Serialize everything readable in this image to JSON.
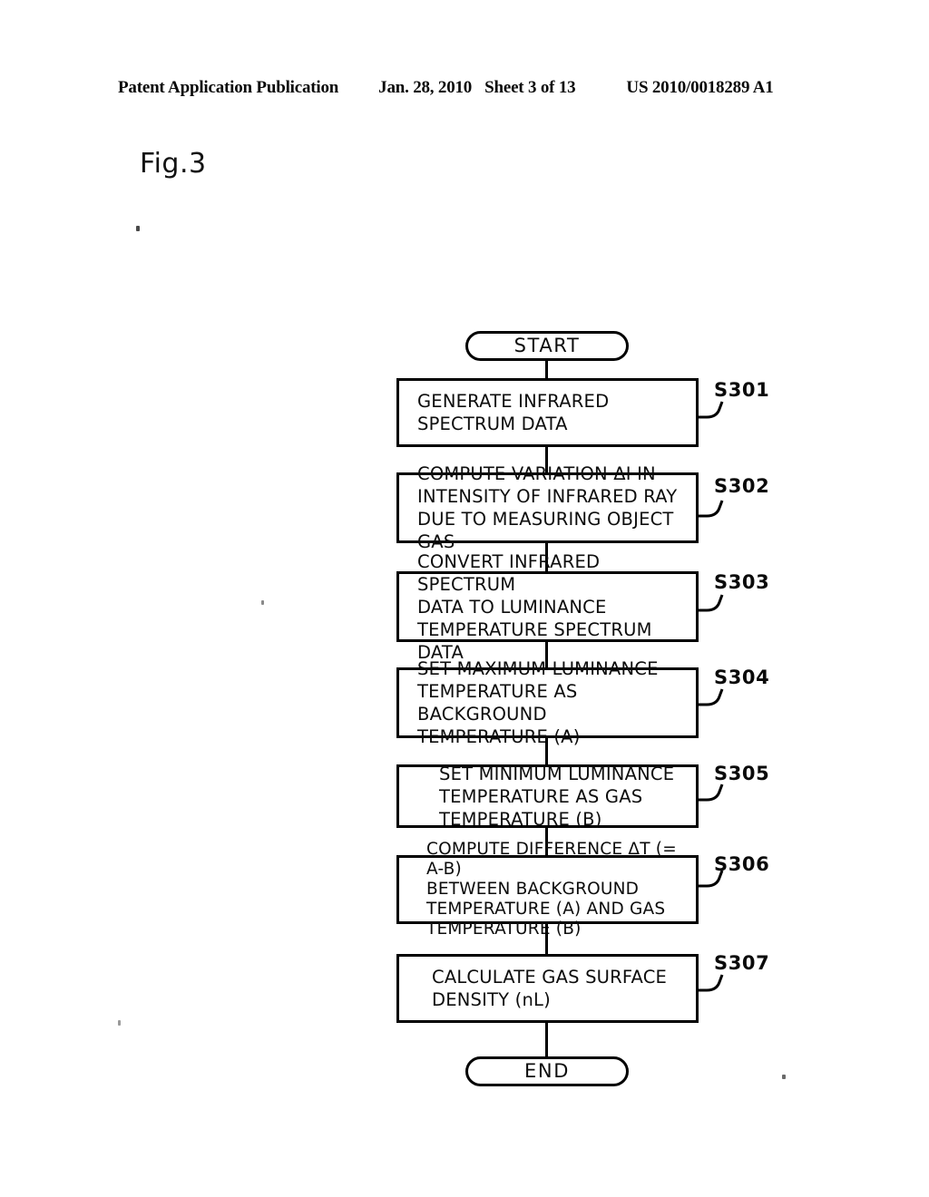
{
  "header": {
    "publication": "Patent Application Publication",
    "date": "Jan. 28, 2010",
    "sheet": "Sheet 3 of 13",
    "patent_number": "US 2010/0018289 A1"
  },
  "figure": {
    "label": "Fig.3"
  },
  "flowchart": {
    "start": {
      "label": "START"
    },
    "end": {
      "label": "END"
    },
    "steps": [
      {
        "ref": "S301",
        "text": "GENERATE INFRARED\nSPECTRUM DATA"
      },
      {
        "ref": "S302",
        "text": "COMPUTE VARIATION ΔI IN\nINTENSITY OF INFRARED RAY\nDUE TO MEASURING OBJECT GAS"
      },
      {
        "ref": "S303",
        "text": "CONVERT INFRARED SPECTRUM\nDATA TO LUMINANCE\nTEMPERATURE SPECTRUM DATA"
      },
      {
        "ref": "S304",
        "text": "SET MAXIMUM LUMINANCE\nTEMPERATURE AS BACKGROUND\nTEMPERATURE (A)"
      },
      {
        "ref": "S305",
        "text": "SET MINIMUM LUMINANCE\nTEMPERATURE AS GAS\nTEMPERATURE (B)"
      },
      {
        "ref": "S306",
        "text": "COMPUTE DIFFERENCE ΔT (= A-B)\nBETWEEN BACKGROUND\nTEMPERATURE (A) AND GAS\nTEMPERATURE (B)"
      },
      {
        "ref": "S307",
        "text": "CALCULATE GAS SURFACE\nDENSITY (nL)"
      }
    ]
  },
  "colors": {
    "ink": "#000000",
    "paper": "#ffffff"
  }
}
